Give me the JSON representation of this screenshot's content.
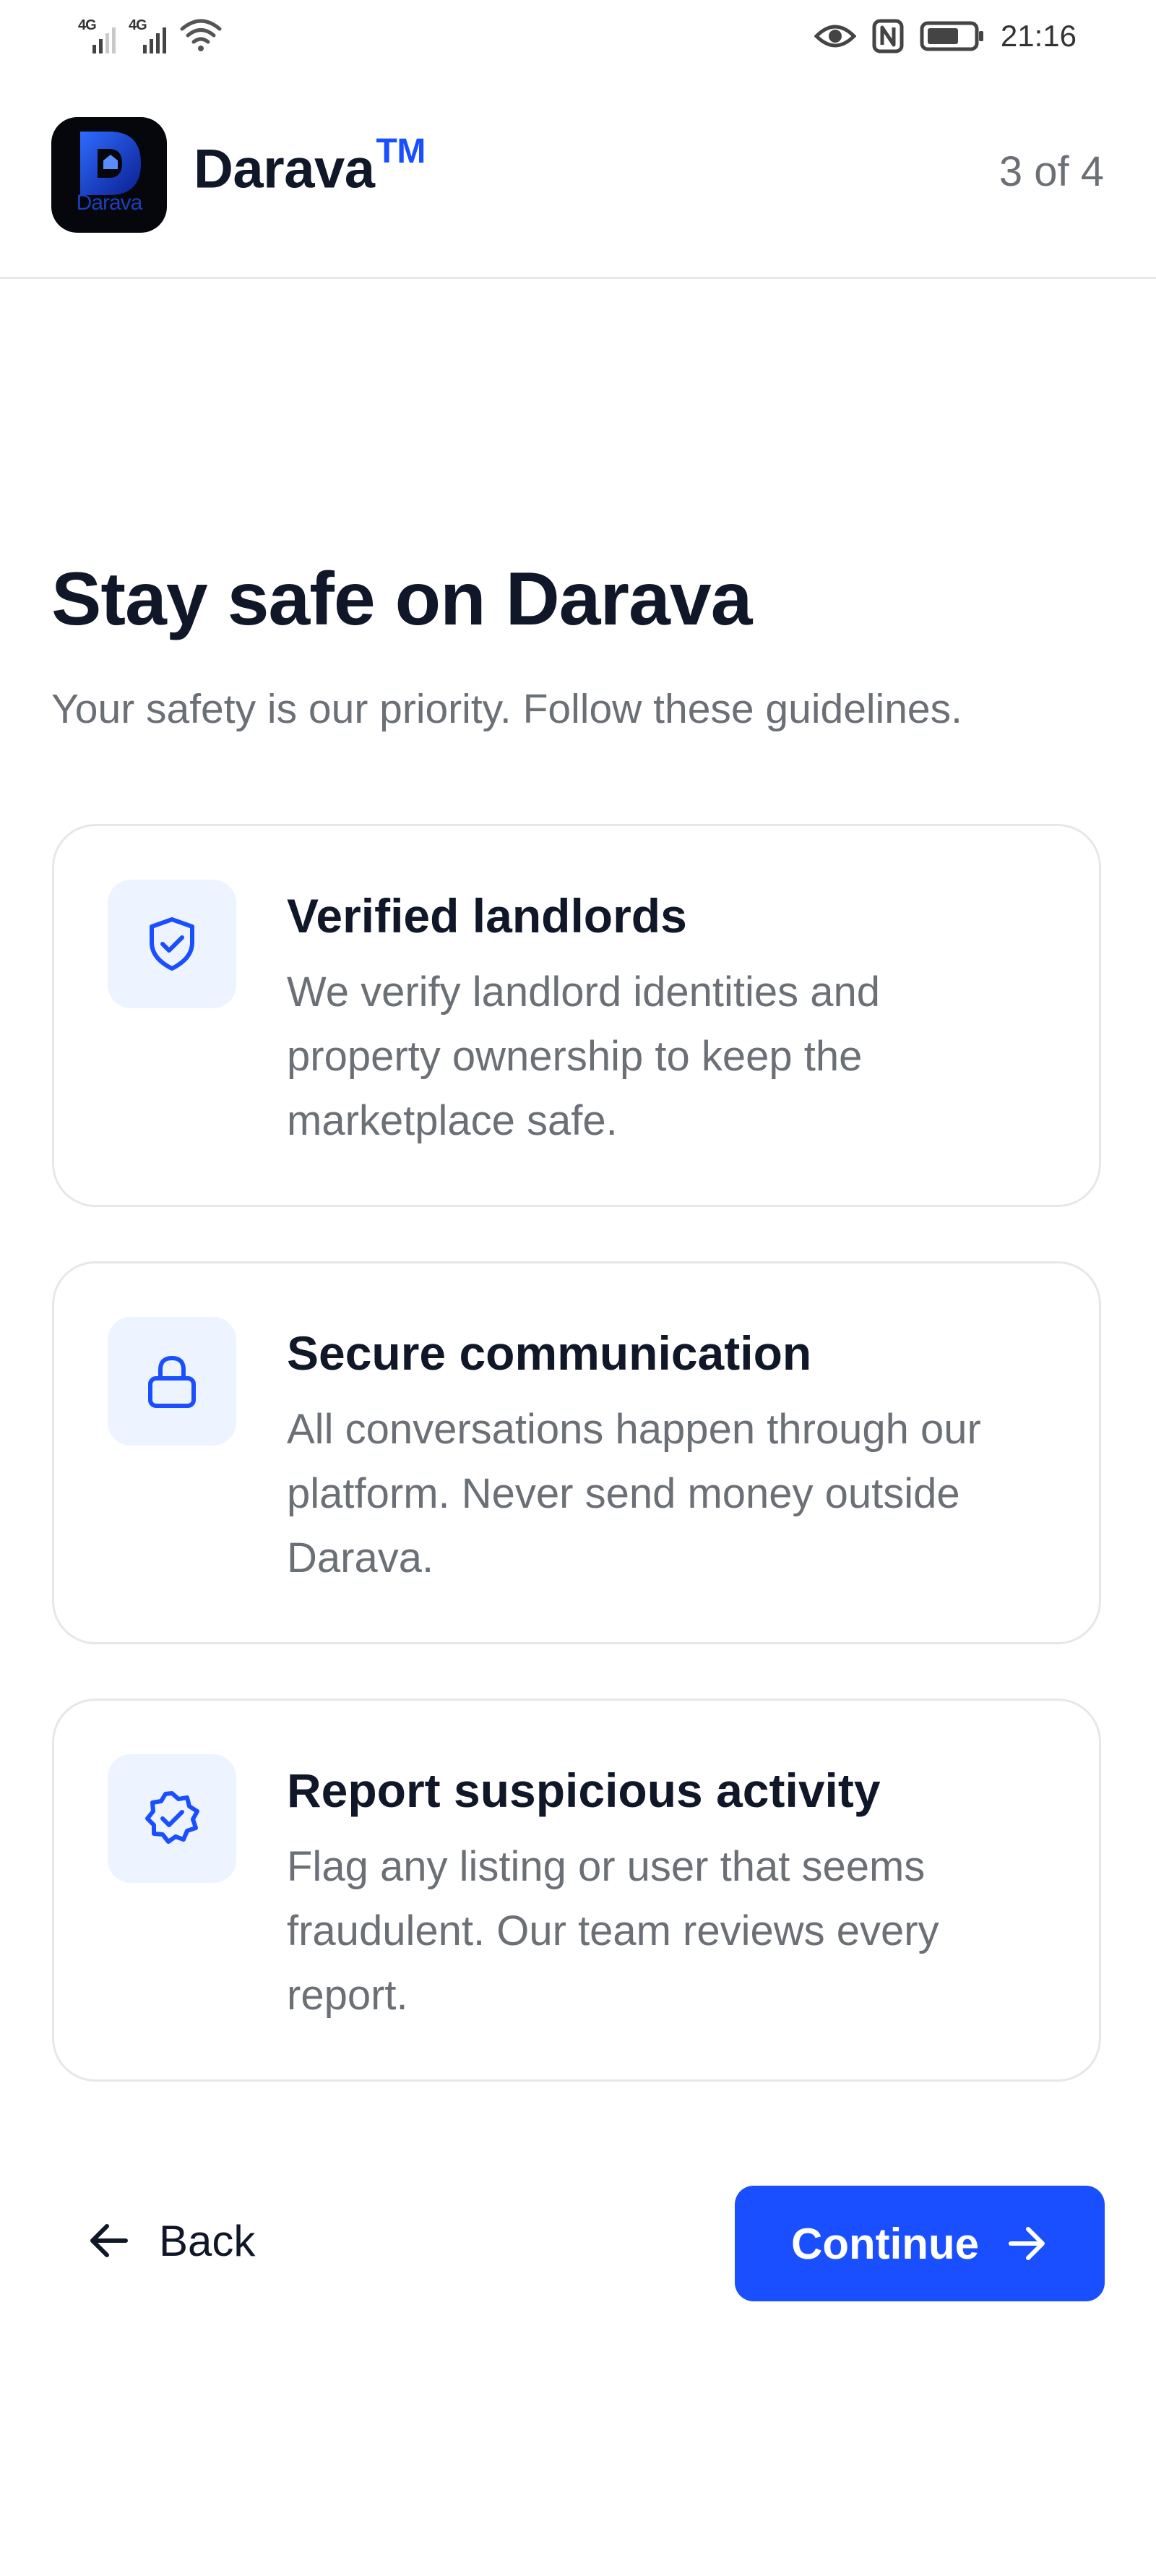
{
  "status_bar": {
    "sim1_network": "4G",
    "sim2_network": "4G",
    "time": "21:16",
    "icons": [
      "signal-icon",
      "wifi-icon",
      "eye-icon",
      "nfc-icon",
      "battery-icon"
    ]
  },
  "header": {
    "logo_text": "Darava",
    "brand_name": "Darava",
    "brand_mark": "TM",
    "step_count": "3 of 4"
  },
  "content": {
    "title": "Stay safe on Darava",
    "subtitle": "Your safety is our priority. Follow these guidelines.",
    "cards": [
      {
        "icon": "shield-check-icon",
        "title": "Verified landlords",
        "body": "We verify landlord identities and property ownership to keep the marketplace safe."
      },
      {
        "icon": "lock-icon",
        "title": "Secure communication",
        "body": "All conversations happen through our platform. Never send money outside Darava."
      },
      {
        "icon": "badge-check-icon",
        "title": "Report suspicious activity",
        "body": "Flag any listing or user that seems fraudulent. Our team reviews every report."
      }
    ]
  },
  "actions": {
    "back_label": "Back",
    "continue_label": "Continue"
  },
  "colors": {
    "accent": "#1a4fff",
    "icon_bg": "#eef4ff",
    "text_primary": "#101729",
    "text_secondary": "#6b6f76",
    "border": "#e5e7eb"
  }
}
